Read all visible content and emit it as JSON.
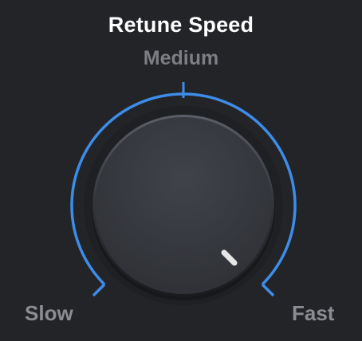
{
  "control": {
    "title": "Retune Speed",
    "value_label": "Medium",
    "min_label": "Slow",
    "max_label": "Fast"
  },
  "colors": {
    "background": "#232428",
    "accent": "#3d8de8",
    "knob": "#3a3c42",
    "indicator": "#e6e6e6",
    "title": "#ffffff",
    "value_text": "#7c7e83",
    "range_text": "#8a8c91"
  },
  "icons": {
    "knob": "rotary-knob",
    "indicator": "knob-pointer"
  }
}
